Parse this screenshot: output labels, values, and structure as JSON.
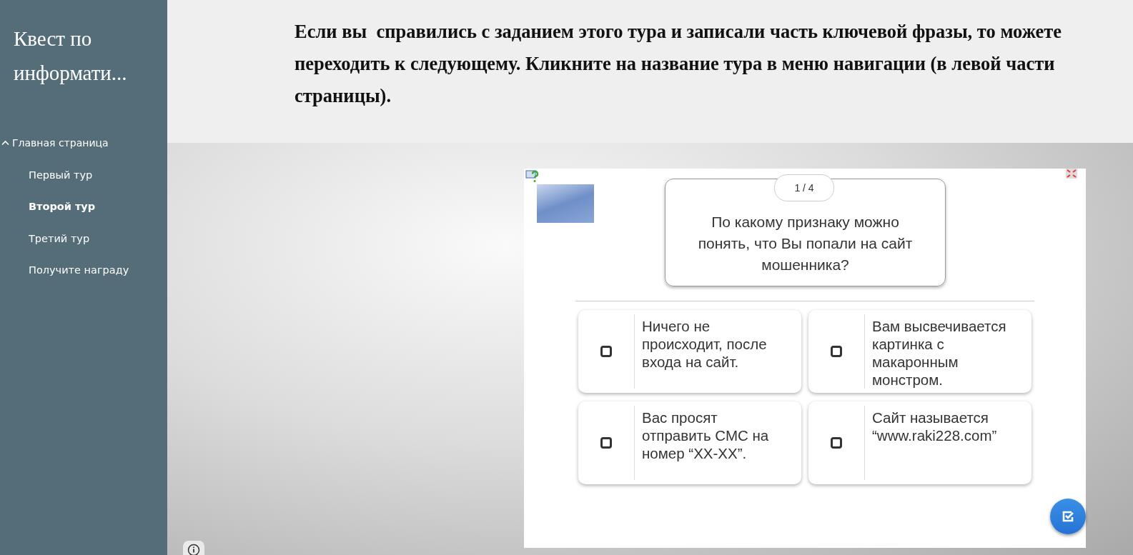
{
  "sidebar": {
    "title": "Квест по информати...",
    "nav": [
      {
        "label": "Главная страница",
        "expanded": true,
        "selected": false,
        "children": [
          {
            "label": "Первый тур",
            "selected": false
          },
          {
            "label": "Второй тур",
            "selected": true
          },
          {
            "label": "Третий тур",
            "selected": false
          },
          {
            "label": "Получите награду",
            "selected": false
          }
        ]
      }
    ]
  },
  "banner": {
    "text": "Если вы  справились с заданием этого тура и записали часть ключевой фразы, то можете переходить к следующему. Кликните на название тура в меню навигации (в левой части страницы)."
  },
  "quiz": {
    "counter": "1 / 4",
    "question": "По какому признаку можно понять, что Вы попали на сайт мошенника?",
    "answers": [
      {
        "text": "Ничего не происходит, после входа на сайт.",
        "checked": false
      },
      {
        "text": "Вам высвечивается картинка с макаронным монстром.",
        "checked": false
      },
      {
        "text": "Вас просят отправить СМС на номер “XX-XX”.",
        "checked": false
      },
      {
        "text": "Сайт называется “www.raki228.com”",
        "checked": false
      }
    ]
  }
}
